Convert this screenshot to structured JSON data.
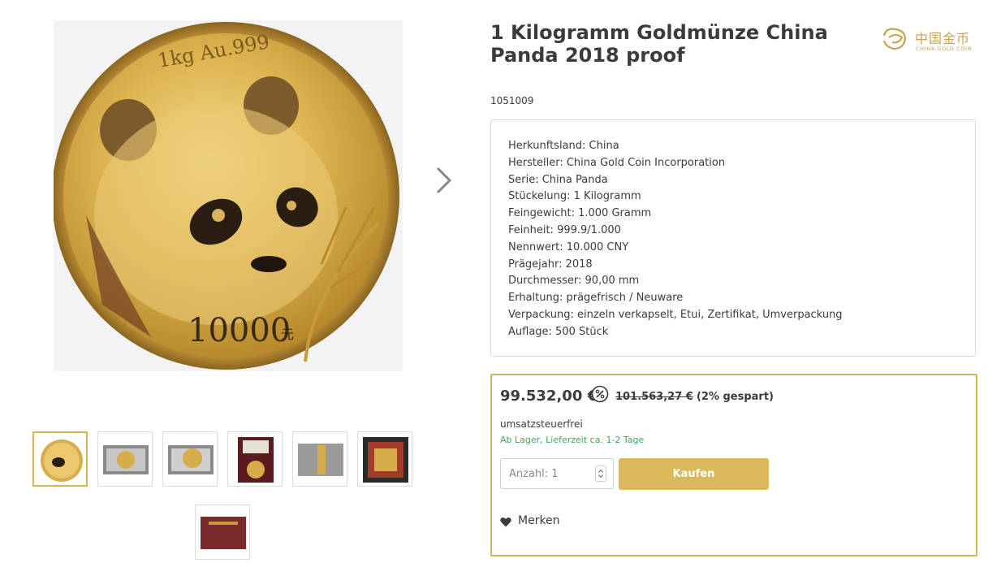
{
  "product": {
    "title": "1 Kilogramm Goldmünze China Panda 2018 proof",
    "sku": "1051009",
    "brand": {
      "name_cn": "中国金币",
      "name_en": "CHINA GOLD COIN"
    },
    "coin_text": {
      "top": "1kg Au.999",
      "denomination": "10000",
      "denomination_unit": "元"
    }
  },
  "properties": [
    "Herkunftsland: China",
    "Hersteller: China Gold Coin Incorporation",
    "Serie: China Panda",
    "Stückelung: 1 Kilogramm",
    "Feingewicht: 1.000 Gramm",
    "Feinheit: 999.9/1.000",
    "Nennwert: 10.000 CNY",
    "Prägejahr: 2018",
    "Durchmesser: 90,00 mm",
    "Erhaltung: prägefrisch / Neuware",
    "Verpackung: einzeln verkapselt, Etui, Zertifikat, Umverpackung",
    "Auflage: 500 Stück"
  ],
  "buy": {
    "price": "99.532,00 €",
    "discount_icon": "percent-badge-icon",
    "old_price": "101.563,27 €",
    "saved": "(2% gespart)",
    "tax_note": "umsatzsteuerfrei",
    "delivery": "Ab Lager, Lieferzeit ca. 1-2 Tage",
    "quantity_label": "Anzahl: 1",
    "buy_label": "Kaufen",
    "wishlist_label": "Merken",
    "wishlist_icon": "heart-icon"
  },
  "gallery": {
    "next_icon": "chevron-right-icon",
    "thumbnails": [
      "coin-front",
      "coin-capsule-display",
      "coin-capsule-display",
      "coin-in-red-case",
      "coin-capsule-side",
      "red-box-open",
      "red-box-closed"
    ],
    "active_index": 0
  },
  "colors": {
    "accent": "#d5b35b",
    "button": "#dbb85c",
    "delivery_green": "#3eab5b",
    "text": "#3b3b3b"
  }
}
